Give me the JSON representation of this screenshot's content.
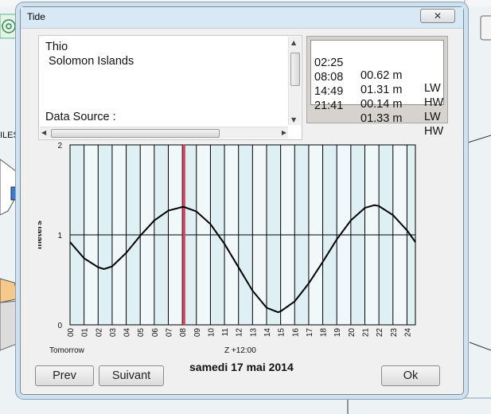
{
  "window": {
    "title": "Tide",
    "close_label": "✕"
  },
  "station": {
    "name": "Thio",
    "region": " Solomon Islands",
    "data_source": "Data Source :"
  },
  "tides": [
    {
      "time": "02:25",
      "height": "00.62 m",
      "type": "LW"
    },
    {
      "time": "08:08",
      "height": "01.31 m",
      "type": "HW"
    },
    {
      "time": "14:49",
      "height": "00.14 m",
      "type": "LW"
    },
    {
      "time": "21:41",
      "height": "01.33 m",
      "type": "HW"
    }
  ],
  "chart": {
    "y_axis_label": "meters",
    "y_ticks": [
      "2",
      "1",
      "0"
    ],
    "x_ticks": [
      "00",
      "01",
      "02",
      "03",
      "04",
      "05",
      "06",
      "07",
      "08",
      "09",
      "10",
      "11",
      "12",
      "13",
      "14",
      "15",
      "16",
      "17",
      "18",
      "19",
      "20",
      "21",
      "22",
      "23",
      "24"
    ],
    "tomorrow_label": "Tomorrow",
    "zone_label": "Z +12:00",
    "date_label": "samedi 17 mai 2014"
  },
  "chart_data": {
    "type": "line",
    "title": "",
    "xlabel": "",
    "ylabel": "meters",
    "xlim": [
      0,
      24.6
    ],
    "ylim": [
      0,
      2
    ],
    "current_time_marker": 8.0,
    "series": [
      {
        "x": [
          0,
          1,
          2,
          2.42,
          3,
          4,
          5,
          6,
          7,
          8,
          8.13,
          9,
          10,
          11,
          12,
          13,
          14,
          14.82,
          15,
          16,
          17,
          18,
          19,
          20,
          21,
          21.68,
          22,
          23,
          24,
          24.6
        ],
        "y": [
          0.92,
          0.74,
          0.64,
          0.62,
          0.65,
          0.8,
          0.99,
          1.16,
          1.27,
          1.31,
          1.31,
          1.26,
          1.12,
          0.9,
          0.64,
          0.38,
          0.19,
          0.14,
          0.15,
          0.26,
          0.46,
          0.7,
          0.95,
          1.16,
          1.3,
          1.33,
          1.32,
          1.22,
          1.05,
          0.92
        ]
      }
    ],
    "grid": true,
    "colors": {
      "curve": "#000000",
      "current_time": "#d9455f",
      "background": "#dff0f4",
      "stripe": "#ffffff"
    }
  },
  "buttons": {
    "prev": "Prev",
    "next": "Suivant",
    "ok": "Ok"
  },
  "map": {
    "label": "ILES"
  }
}
